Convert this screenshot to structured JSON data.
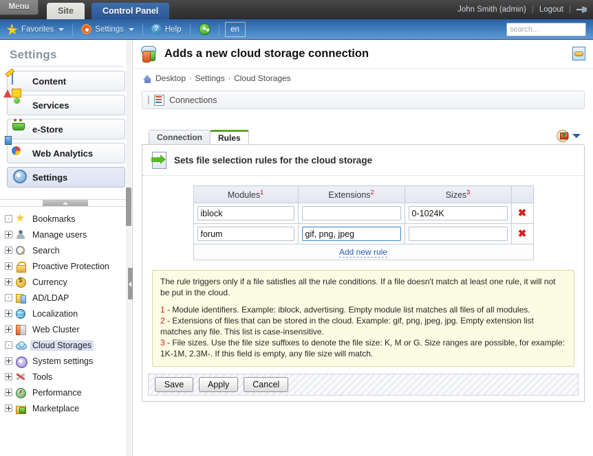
{
  "topbar": {
    "menu_label": "Menu",
    "tabs": [
      {
        "label": "Site",
        "active": false
      },
      {
        "label": "Control Panel",
        "active": true
      }
    ],
    "user_label": "John Smith (admin)",
    "logout_label": "Logout",
    "pin_icon": "pin-icon"
  },
  "toolbar": {
    "favorites_label": "Favorites",
    "settings_label": "Settings",
    "help_label": "Help",
    "sync_icon": "sync-icon",
    "language": "en",
    "search_placeholder": "search...",
    "search_value": "",
    "search_icon": "search-icon"
  },
  "sidebar": {
    "title": "Settings",
    "buttons": [
      {
        "label": "Content",
        "icon": "content-icon",
        "active": false
      },
      {
        "label": "Services",
        "icon": "services-icon",
        "active": false
      },
      {
        "label": "e-Store",
        "icon": "cart-icon",
        "active": false
      },
      {
        "label": "Web Analytics",
        "icon": "pie-chart-icon",
        "active": false
      },
      {
        "label": "Settings",
        "icon": "gear-icon",
        "active": true
      }
    ],
    "tree": [
      {
        "label": "Bookmarks",
        "icon": "star-icon",
        "expand": "dot",
        "selected": false
      },
      {
        "label": "Manage users",
        "icon": "user-icon",
        "expand": "plus",
        "selected": false
      },
      {
        "label": "Search",
        "icon": "magnifier-icon",
        "expand": "plus",
        "selected": false
      },
      {
        "label": "Proactive Protection",
        "icon": "lock-icon",
        "expand": "plus",
        "selected": false
      },
      {
        "label": "Currency",
        "icon": "coin-icon",
        "expand": "plus",
        "selected": false
      },
      {
        "label": "AD/LDAP",
        "icon": "ldap-icon",
        "expand": "dot",
        "selected": false
      },
      {
        "label": "Localization",
        "icon": "globe-icon",
        "expand": "plus",
        "selected": false
      },
      {
        "label": "Web Cluster",
        "icon": "cluster-icon",
        "expand": "plus",
        "selected": false
      },
      {
        "label": "Cloud Storages",
        "icon": "cloud-icon",
        "expand": "dot",
        "selected": true
      },
      {
        "label": "System settings",
        "icon": "system-gear-icon",
        "expand": "plus",
        "selected": false
      },
      {
        "label": "Tools",
        "icon": "tools-icon",
        "expand": "plus",
        "selected": false
      },
      {
        "label": "Performance",
        "icon": "gauge-icon",
        "expand": "plus",
        "selected": false
      },
      {
        "label": "Marketplace",
        "icon": "marketplace-icon",
        "expand": "plus",
        "selected": false
      }
    ]
  },
  "main": {
    "page_title": "Adds a new cloud storage connection",
    "title_icon": "cloud-database-icon",
    "head_link_icon": "link-page-icon",
    "breadcrumb": {
      "home_icon": "home-icon",
      "items": [
        "Desktop",
        "Settings",
        "Cloud Storages"
      ],
      "separator": "›"
    },
    "connections_bar": {
      "label": "Connections",
      "icon": "connections-icon"
    },
    "tabs": [
      {
        "label": "Connection",
        "active": false
      },
      {
        "label": "Rules",
        "active": true
      }
    ],
    "tab_tools": {
      "download_icon": "download-icon",
      "caret_icon": "chevron-down-icon"
    },
    "panel": {
      "heading": "Sets file selection rules for the cloud storage",
      "heading_icon": "rules-document-icon"
    },
    "rules_table": {
      "columns": [
        {
          "label": "Modules",
          "sup": "1"
        },
        {
          "label": "Extensions",
          "sup": "2"
        },
        {
          "label": "Sizes",
          "sup": "3"
        }
      ],
      "delete_icon": "delete-icon",
      "rows": [
        {
          "modules": "iblock",
          "extensions": "",
          "sizes": "0-1024K",
          "focused_field": null
        },
        {
          "modules": "forum",
          "extensions": "gif, png, jpeg",
          "sizes": "",
          "focused_field": "extensions"
        }
      ],
      "add_new_label": "Add new rule"
    },
    "note": {
      "intro": "The rule triggers only if a file satisfies all the rule conditions. If a file doesn't match at least one rule, it will not be put in the cloud.",
      "lines": [
        {
          "num": "1",
          "text": " - Module identifiers. Example: iblock, advertising. Empty module list matches all files of all modules."
        },
        {
          "num": "2",
          "text": " - Extensions of files that can be stored in the cloud. Example: gif, png, jpeg, jpg. Empty extension list matches any file. This list is case-insensitive."
        },
        {
          "num": "3",
          "text": " - File sizes. Use the file size suffixes to denote the file size: K, M or G. Size ranges are possible, for example: 1K-1M, 2.3M-. If this field is empty, any file size will match."
        }
      ]
    },
    "buttons": [
      {
        "label": "Save"
      },
      {
        "label": "Apply"
      },
      {
        "label": "Cancel"
      }
    ]
  },
  "colors": {
    "accent_blue": "#2b5796",
    "toolbar_blue": "#3f7ec0",
    "active_tab_green": "#5aa822",
    "note_bg": "#fcfbe3",
    "note_border": "#ddd9a8",
    "danger_red": "#cc2222",
    "link_blue": "#2a58b4"
  }
}
